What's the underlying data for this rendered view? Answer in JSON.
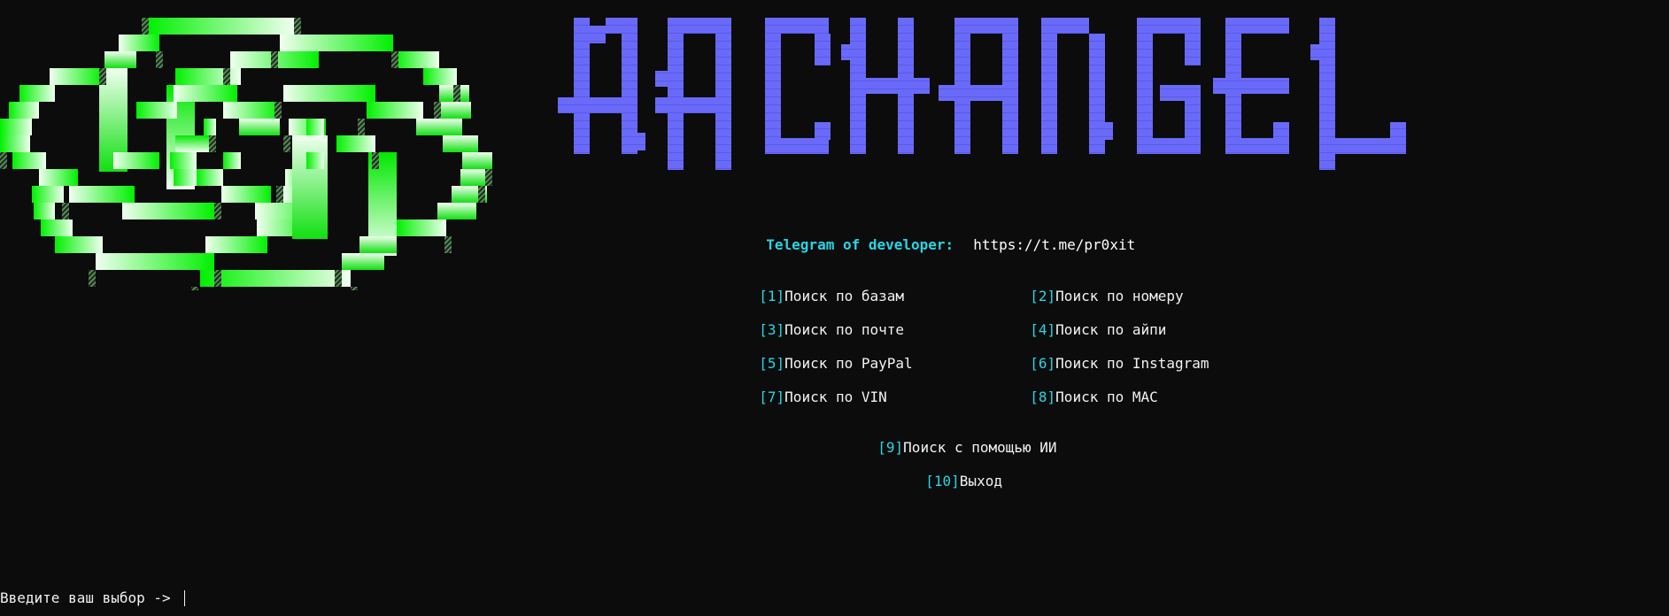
{
  "colors": {
    "background": "#0c0c0c",
    "accent_cyan": "#2ad4e4",
    "text": "#f2f2f2",
    "title_purple": "#6a6afa",
    "logo_green": "#00ff00",
    "logo_light": "#e8ffe0"
  },
  "icons": {
    "logo": "green-knot-logo-icon",
    "title": "archangel-title-art"
  },
  "header": {
    "title_art_text": "ARCHANGEL",
    "dev_label": "Telegram of developer:",
    "dev_url": "https://t.me/pr0xit"
  },
  "menu": {
    "items": [
      {
        "key": "[1]",
        "label": "Поиск по базам"
      },
      {
        "key": "[2]",
        "label": "Поиск по номеру"
      },
      {
        "key": "[3]",
        "label": "Поиск по почте"
      },
      {
        "key": "[4]",
        "label": "Поиск по айпи"
      },
      {
        "key": "[5]",
        "label": "Поиск по PayPal"
      },
      {
        "key": "[6]",
        "label": "Поиск по Instagram"
      },
      {
        "key": "[7]",
        "label": "Поиск по VIN"
      },
      {
        "key": "[8]",
        "label": "Поиск по MAC"
      },
      {
        "key": "[9]",
        "label": "Поиск с помощью ИИ"
      },
      {
        "key": "[10]",
        "label": "Выход"
      }
    ]
  },
  "prompt": {
    "text": "Введите ваш выбор -> ",
    "value": ""
  }
}
